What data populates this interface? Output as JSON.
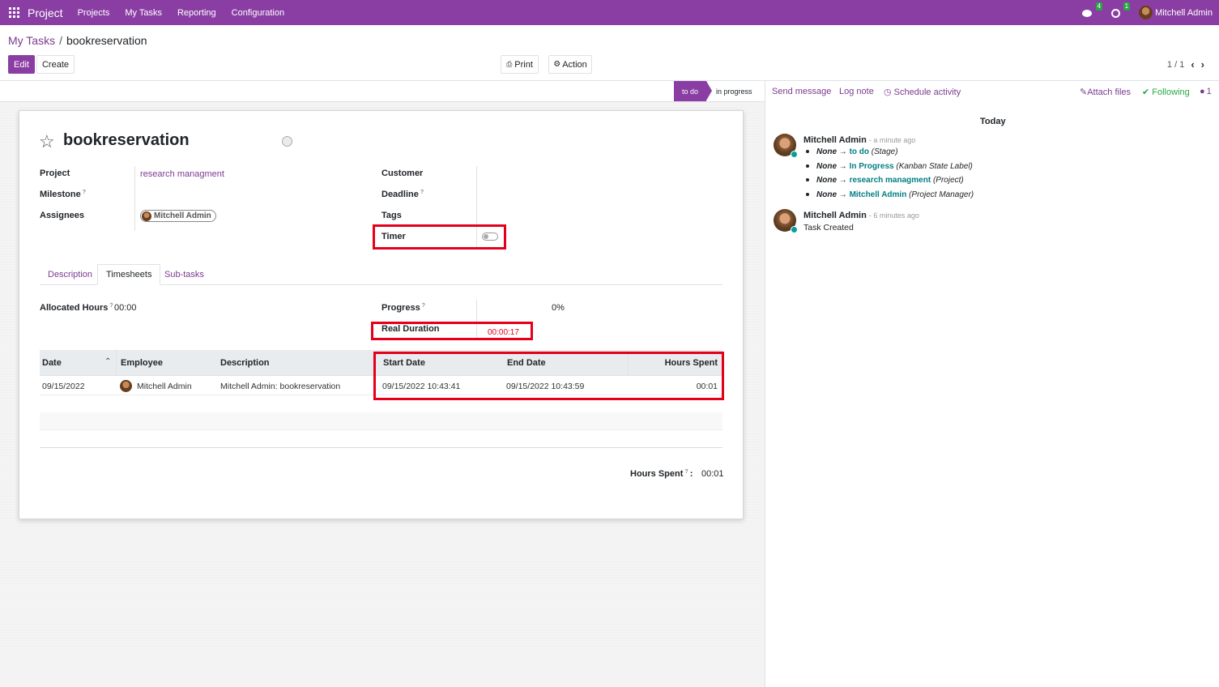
{
  "navbar": {
    "app_name": "Project",
    "menus": [
      "Projects",
      "My Tasks",
      "Reporting",
      "Configuration"
    ],
    "messages_badge": "4",
    "activities_badge": "1",
    "user": "Mitchell Admin"
  },
  "breadcrumb": {
    "parent": "My Tasks",
    "separator": "/",
    "current": "bookreservation"
  },
  "toolbar": {
    "edit": "Edit",
    "create": "Create",
    "print": "Print",
    "action": "Action"
  },
  "pager": {
    "value": "1 / 1"
  },
  "statusbar": {
    "stages": [
      "to do",
      "in progress"
    ],
    "active": "to do"
  },
  "task": {
    "title": "bookreservation",
    "fields": {
      "project_label": "Project",
      "project_value": "research managment",
      "milestone_label": "Milestone",
      "assignees_label": "Assignees",
      "assignee": "Mitchell Admin",
      "customer_label": "Customer",
      "deadline_label": "Deadline",
      "tags_label": "Tags",
      "timer_label": "Timer",
      "help": "?"
    }
  },
  "tabs": [
    "Description",
    "Timesheets",
    "Sub-tasks"
  ],
  "timesheet": {
    "allocated_label": "Allocated Hours",
    "allocated_value": "00:00",
    "progress_label": "Progress",
    "progress_value": "0%",
    "real_duration_label": "Real Duration",
    "real_duration_value": "00:00:17",
    "columns": [
      "Date",
      "Employee",
      "Description",
      "Start Date",
      "End Date",
      "Hours Spent"
    ],
    "rows": [
      {
        "date": "09/15/2022",
        "employee": "Mitchell Admin",
        "description": "Mitchell Admin: bookreservation",
        "start": "09/15/2022 10:43:41",
        "end": "09/15/2022 10:43:59",
        "hours": "00:01"
      }
    ],
    "total_label": "Hours Spent",
    "total_colon": ":",
    "total_value": "00:01"
  },
  "chatter": {
    "send_message": "Send message",
    "log_note": "Log note",
    "schedule_activity": "Schedule activity",
    "attach_files": "Attach files",
    "following": "Following",
    "followers_count": "1",
    "date_separator": "Today",
    "messages": [
      {
        "author": "Mitchell Admin",
        "time": "- a minute ago",
        "changes": [
          {
            "old": "None",
            "arrow": "→",
            "new": "to do",
            "field": "(Stage)"
          },
          {
            "old": "None",
            "arrow": "→",
            "new": "In Progress",
            "field": "(Kanban State Label)"
          },
          {
            "old": "None",
            "arrow": "→",
            "new": "research managment",
            "field": "(Project)"
          },
          {
            "old": "None",
            "arrow": "→",
            "new": "Mitchell Admin",
            "field": "(Project Manager)"
          }
        ]
      },
      {
        "author": "Mitchell Admin",
        "time": "- 6 minutes ago",
        "body": "Task Created"
      }
    ]
  },
  "colors": {
    "brand": "#8a3ea3",
    "highlight": "#e4001b",
    "following": "#28a745"
  }
}
